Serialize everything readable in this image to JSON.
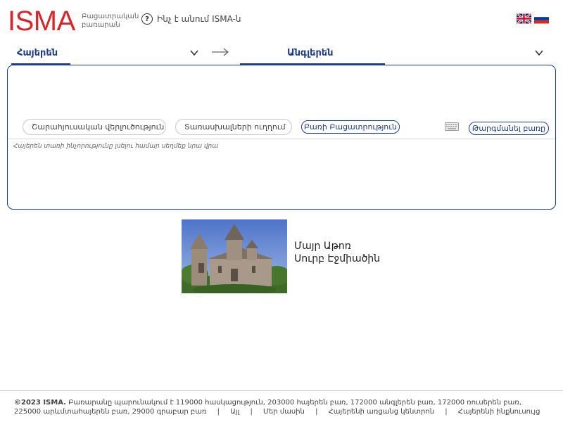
{
  "header": {
    "logo": "ISMA",
    "subtitle_line1": "Բացատրական",
    "subtitle_line2": "բառարան",
    "help_icon": "help-circle-icon",
    "help_label": "Ինչ է անում ISMA-ն",
    "flags": [
      {
        "name": "english-flag-icon"
      },
      {
        "name": "russian-flag-icon"
      }
    ]
  },
  "languages": {
    "source": "Հայերեն",
    "target": "Անգլերեն",
    "swap_icon": "arrow-right-icon",
    "dropdown_icon": "chevron-down-icon"
  },
  "editor": {
    "input_value": "",
    "tools": {
      "synonym_analysis": {
        "label": "Շարահյուսական վերլուծություն",
        "icon": "list-circle-icon"
      },
      "spell_check": {
        "label": "Տառասխալների ուղղում",
        "icon": "spellcheck-icon"
      },
      "word_explanation": {
        "label": "Բառի Բացատրություն"
      }
    },
    "keyboard_icon": "keyboard-icon",
    "translate_label": "Թարգմանել բառը",
    "hint": "Հայերեն տառի ինչորությունը լսելու համար սեղմեք նրա վրա"
  },
  "feature": {
    "image_icon": "cathedral-photo",
    "caption_line1": "Մայր Աթոռ",
    "caption_line2": "Սուրբ Էջմիածին"
  },
  "footer": {
    "copyright": "©2023 ISMA.",
    "stats": "Բառարանը պարունակում է 119000 հասկացություն, 203000 հայերեն բառ, 172000 անգլերեն բառ, 172000 ռուսերեն բառ, 225000 արևմտահայերեն բառ, 29000 գրաբար բառ",
    "links": [
      "Այլ",
      "Մեր մասին",
      "Հայերենի առցանց կենտրոն",
      "Հայերենի ինքնուսույց"
    ]
  },
  "colors": {
    "brand_red": "#d7262b",
    "accent_blue": "#1f3c88"
  }
}
